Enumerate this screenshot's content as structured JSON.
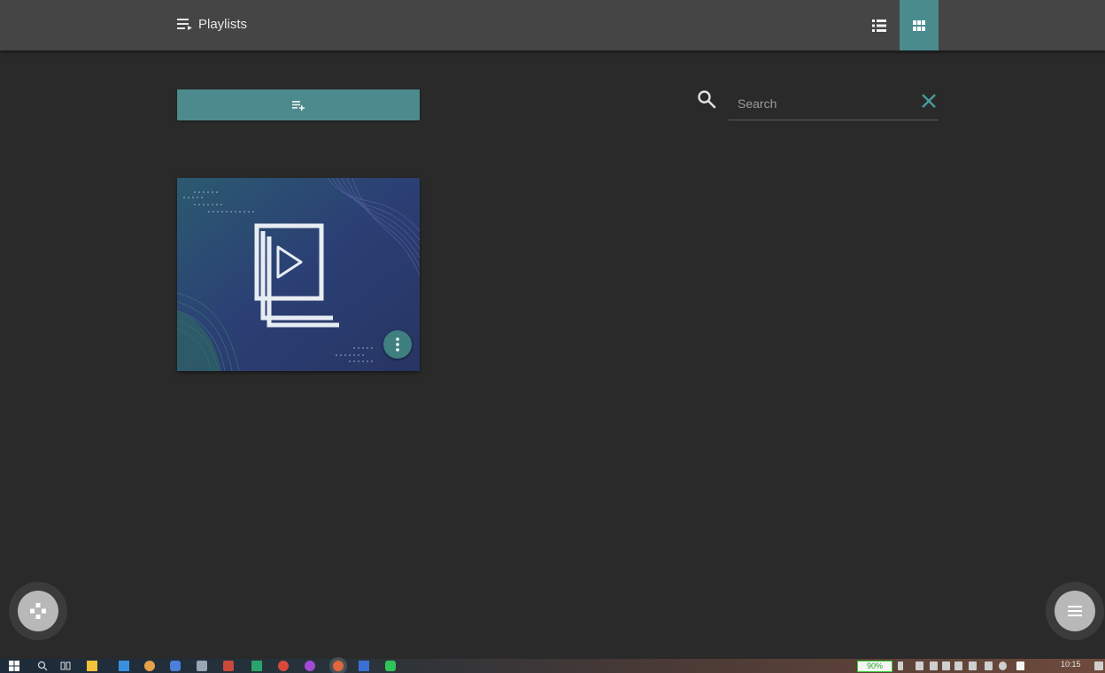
{
  "header": {
    "title": "Playlists",
    "title_icon": "playlist-icon",
    "view_list_icon": "list-view-icon",
    "view_grid_icon": "grid-view-icon",
    "active_view": "grid"
  },
  "toolbar": {
    "new_playlist_icon": "playlist-add-icon"
  },
  "search": {
    "placeholder": "Search",
    "value": "",
    "clear_icon": "close-icon"
  },
  "playlists": [
    {
      "thumbnail_icon": "video-library-icon",
      "menu_icon": "more-vertical-icon"
    }
  ],
  "fabs": {
    "left_icon": "gamepad-icon",
    "right_icon": "menu-icon"
  },
  "taskbar": {
    "battery_label": "90%",
    "clock": "10:15"
  },
  "colors": {
    "accent": "#4a8b8e",
    "background": "#2a2a2a",
    "header": "#454545"
  }
}
